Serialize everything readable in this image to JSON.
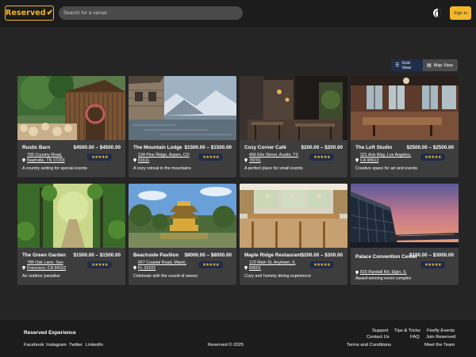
{
  "header": {
    "logo_text": "Reserved",
    "search_placeholder": "Search for a venue",
    "signin_label": "Sign in"
  },
  "view_toggle": {
    "grid_label": "Grid View",
    "map_label": "Map View",
    "selected": "Grid View"
  },
  "venues": [
    {
      "name": "Rustic Barn",
      "price": "$4500.00 – $4500.00",
      "address": "765 Country Road, Nashville, TN 37203",
      "rating": 5,
      "description": "A country setting for special events"
    },
    {
      "name": "The Mountain Lodge",
      "price": "$1500.00 – $1500.00",
      "address": "234 Pine Ridge, Aspen, CO 81611",
      "rating": 5,
      "description": "A cozy retreat in the mountains"
    },
    {
      "name": "Cozy Corner Café",
      "price": "$200.00 – $200.00",
      "address": "456 Elm Street, Austin, TX 78701",
      "rating": 5,
      "description": "A perfect place for small events"
    },
    {
      "name": "The Loft Studio",
      "price": "$2500.00 – $2500.00",
      "address": "321 Arts Way, Los Angeles, CA 90013",
      "rating": 5,
      "description": "Creative space for art and events"
    },
    {
      "name": "The Green Garden",
      "price": "$1500.00 – $1500.00",
      "address": "789 Oak Lane, San Francisco, CA 94102",
      "rating": 5,
      "description": "An outdoor paradise"
    },
    {
      "name": "Beachside Pavilion",
      "price": "$8000.00 – $8000.00",
      "address": "667 Coastal Road, Miami, FL 33101",
      "rating": 5,
      "description": "Celebrate with the sound of waves"
    },
    {
      "name": "Maple Ridge Restaurant",
      "price": "$200.00 – $300.00",
      "address": "123 Main St, Anytown, IL 60601",
      "rating": 5,
      "description": "Cozy and homely dining experience"
    },
    {
      "name": "Palace Convention Center",
      "price": "$100.00 – $3000.00",
      "address": "815 Randall Rd, Elgin, IL",
      "rating": 5,
      "description": "Award-winning event complex"
    }
  ],
  "stars_text": "★★★★★",
  "footer": {
    "title": "Reserved Experience",
    "social": [
      "Facebook",
      "Instagram",
      "Twitter",
      "LinkedIn"
    ],
    "copyright": "Reserved © 2025",
    "links": [
      "Support",
      "Tips & Tricks",
      "Firefly Events",
      "Contact Us",
      "FAQ",
      "Join Reserved",
      "Terms and Conditions",
      "Meet the Team"
    ]
  },
  "colors": {
    "accent": "#f3b72a",
    "background": "#252525",
    "card": "#3d3d3d",
    "toggle_active": "#1f2c4a"
  }
}
